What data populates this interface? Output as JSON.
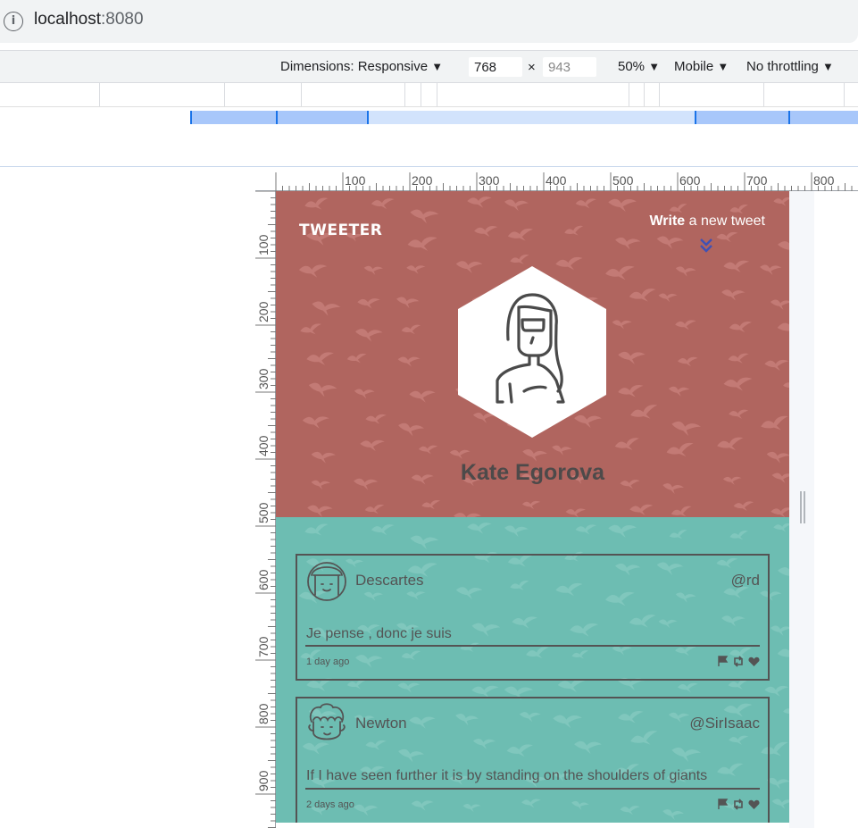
{
  "browser": {
    "info_icon": "info-icon",
    "host": "localhost",
    "port": ":8080"
  },
  "devtools": {
    "dimensions_label": "Dimensions: Responsive",
    "width_value": "768",
    "height_value": "943",
    "times": "×",
    "zoom": "50%",
    "device_type": "Mobile",
    "throttling": "No throttling",
    "dropdown_arrow": "▼"
  },
  "ruler": {
    "h_labels": [
      "100",
      "200",
      "300",
      "400",
      "500",
      "600",
      "700",
      "800"
    ],
    "v_labels": [
      "100",
      "200",
      "300",
      "400",
      "500",
      "600",
      "700",
      "800",
      "900"
    ]
  },
  "colors": {
    "hero_bg": "#b0655f",
    "feed_bg": "#6dbdb2",
    "accent_chevron": "#3f51b5",
    "ink": "#545454"
  },
  "header": {
    "logo": "TWEETER",
    "write_bold": "Write",
    "write_rest": " a new tweet",
    "chevron_icon": "double-chevron-down-icon"
  },
  "profile": {
    "name": "Kate Egorova",
    "avatar_icon": "woman-avatar-icon"
  },
  "tweets": [
    {
      "author": "Descartes",
      "handle": "@rd",
      "text": "Je pense , donc je suis",
      "time": "1 day ago",
      "avatar_icon": "girl-avatar-icon"
    },
    {
      "author": "Newton",
      "handle": "@SirIsaac",
      "text": "If I have seen further it is by standing on the shoulders of giants",
      "time": "2 days ago",
      "avatar_icon": "curly-man-avatar-icon"
    }
  ],
  "actions": [
    "flag-icon",
    "retweet-icon",
    "heart-icon"
  ]
}
